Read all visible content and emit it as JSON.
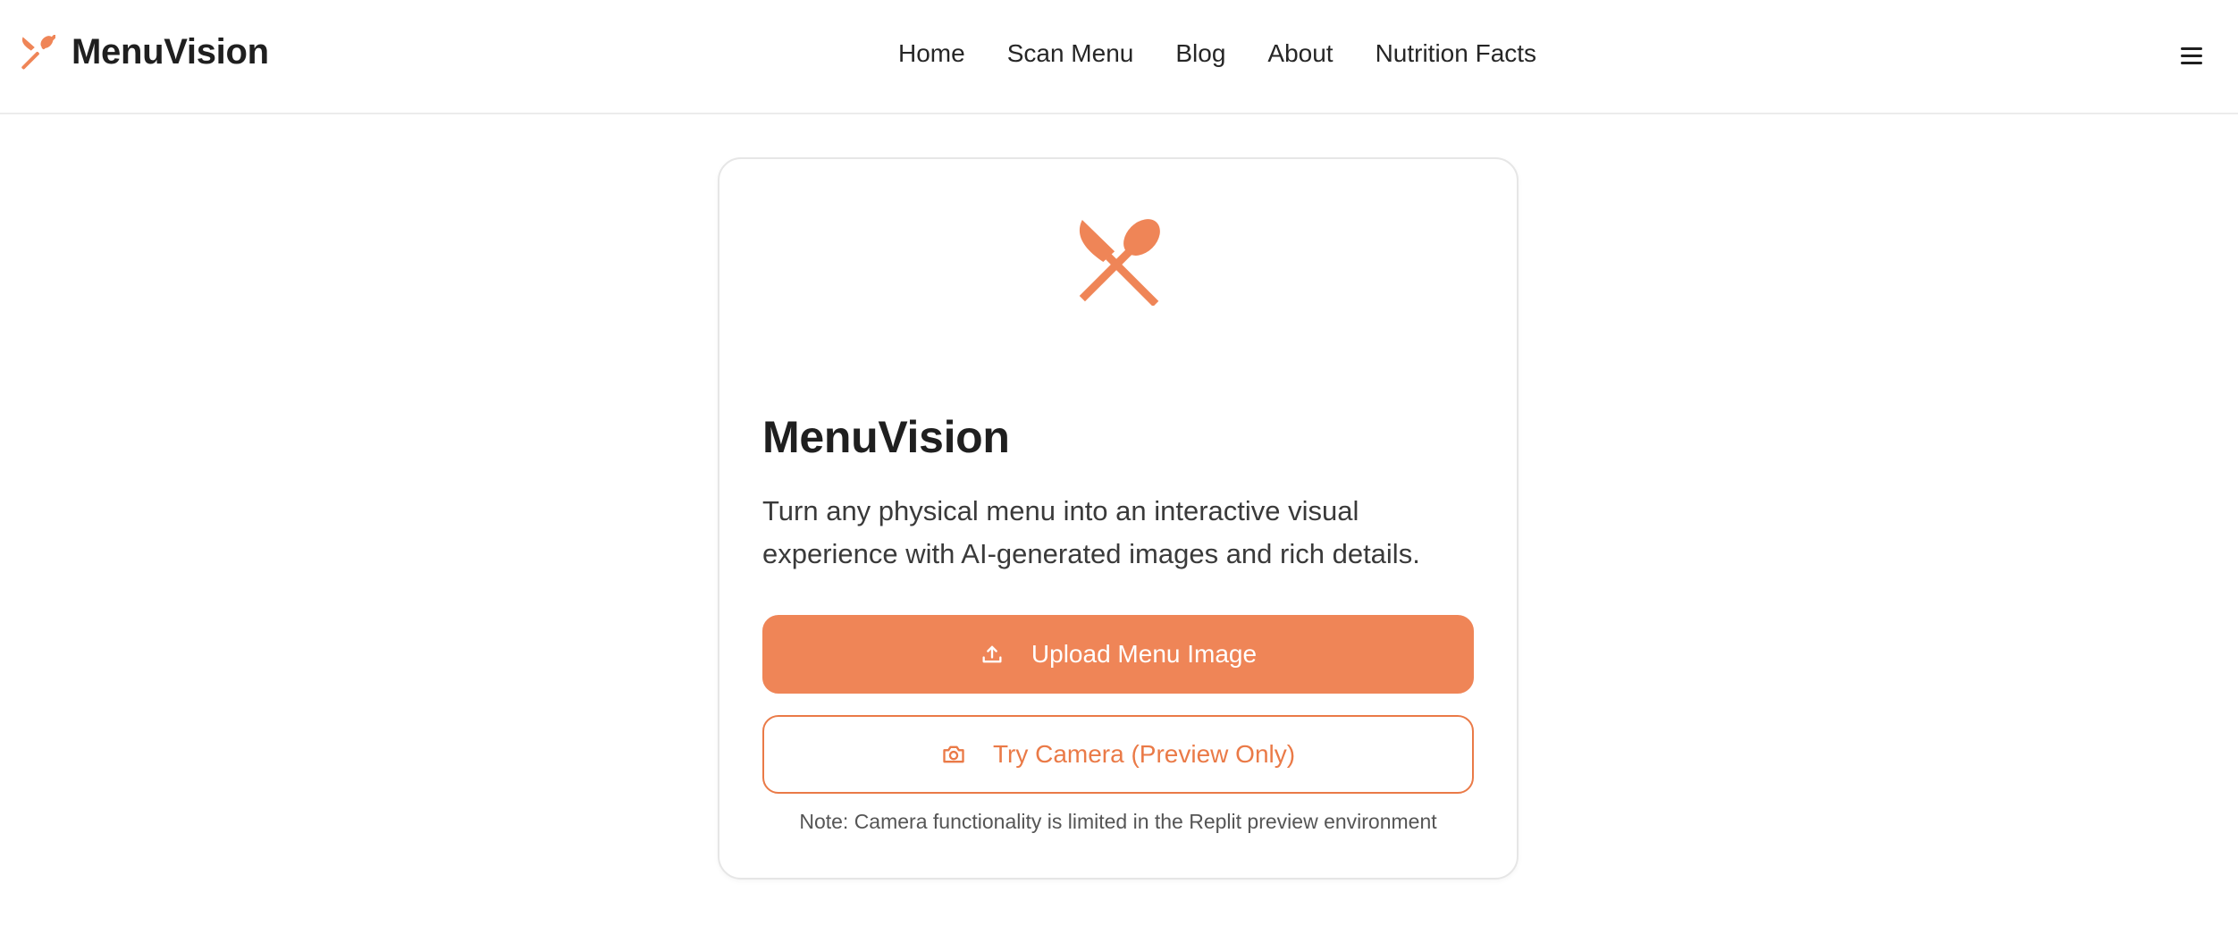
{
  "brand": {
    "name": "MenuVision",
    "icon": "utensils-icon",
    "accent_color": "#ef8557"
  },
  "nav": {
    "items": [
      {
        "label": "Home"
      },
      {
        "label": "Scan Menu"
      },
      {
        "label": "Blog"
      },
      {
        "label": "About"
      },
      {
        "label": "Nutrition Facts"
      }
    ],
    "menu_icon": "hamburger-menu-icon"
  },
  "card": {
    "icon": "knife-spoon-icon",
    "title": "MenuVision",
    "description": "Turn any physical menu into an interactive visual experience with AI-generated images and rich details.",
    "upload_button": {
      "label": "Upload Menu Image",
      "icon": "upload-icon"
    },
    "camera_button": {
      "label": "Try Camera (Preview Only)",
      "icon": "camera-icon"
    },
    "note": "Note: Camera functionality is limited in the Replit preview environment"
  }
}
